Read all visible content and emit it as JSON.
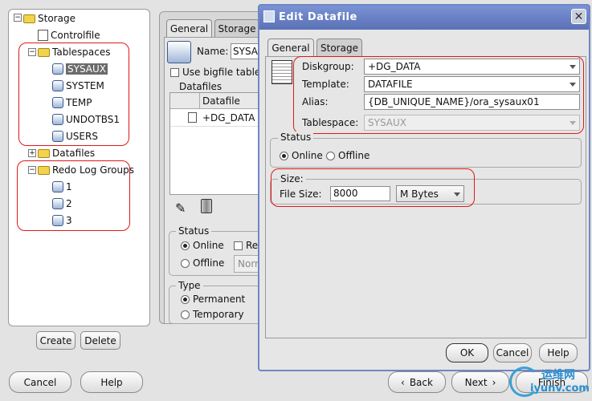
{
  "tree": {
    "root": "Storage",
    "controlfile": "Controlfile",
    "tablespaces": "Tablespaces",
    "tablespace_items": [
      "SYSAUX",
      "SYSTEM",
      "TEMP",
      "UNDOTBS1",
      "USERS"
    ],
    "datafiles": "Datafiles",
    "redo_log_groups": "Redo Log Groups",
    "redo_items": [
      "1",
      "2",
      "3"
    ]
  },
  "left_buttons": {
    "create": "Create",
    "delete": "Delete"
  },
  "bottom": {
    "cancel": "Cancel",
    "help": "Help",
    "back": "Back",
    "next": "Next",
    "finish": "Finish"
  },
  "main_panel": {
    "tabs": [
      "General",
      "Storage"
    ],
    "name_label": "Name:",
    "name_value": "SYSAUX",
    "use_bigfile": "Use bigfile table",
    "datafiles_label": "Datafiles",
    "datafile_col": "Datafile",
    "datafile_row": "+DG_DATA",
    "status_label": "Status",
    "online": "Online",
    "offline": "Offline",
    "read_only": "Re",
    "normal": "Norm",
    "type_label": "Type",
    "permanent": "Permanent",
    "temporary": "Temporary"
  },
  "dialog": {
    "title": "Edit Datafile",
    "tabs": [
      "General",
      "Storage"
    ],
    "diskgroup_label": "Diskgroup:",
    "diskgroup_value": "+DG_DATA",
    "template_label": "Template:",
    "template_value": "DATAFILE",
    "alias_label": "Alias:",
    "alias_value": "{DB_UNIQUE_NAME}/ora_sysaux01",
    "tablespace_label": "Tablespace:",
    "tablespace_value": "SYSAUX",
    "status_label": "Status",
    "online": "Online",
    "offline": "Offline",
    "size_label": "Size:",
    "file_size_label": "File Size:",
    "file_size_value": "8000",
    "unit_value": "M Bytes",
    "ok": "OK",
    "cancel": "Cancel",
    "help": "Help"
  },
  "watermark": {
    "text": "运维网",
    "url": "iyunv.com"
  }
}
